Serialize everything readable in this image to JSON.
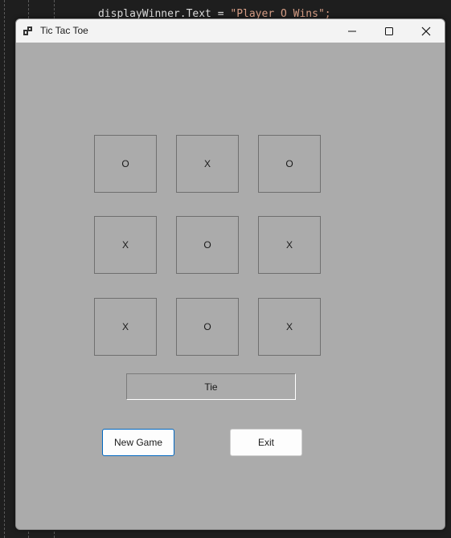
{
  "background_code": {
    "identifier": "displayWinner.Text = ",
    "string_literal": "\"Player O Wins\";"
  },
  "window": {
    "title": "Tic Tac Toe",
    "icon": "app-window-icon",
    "controls": {
      "minimize_icon": "minimize-icon",
      "maximize_icon": "maximize-icon",
      "close_icon": "close-icon"
    }
  },
  "board": {
    "cells": [
      "O",
      "X",
      "O",
      "X",
      "O",
      "X",
      "X",
      "O",
      "X"
    ]
  },
  "result_label": "Tie",
  "buttons": {
    "new_game": "New Game",
    "exit": "Exit"
  },
  "colors": {
    "client_background": "#ababab",
    "titlebar": "#f3f3f3",
    "focus_border": "#0067c0",
    "string_literal": "#d69d85"
  }
}
